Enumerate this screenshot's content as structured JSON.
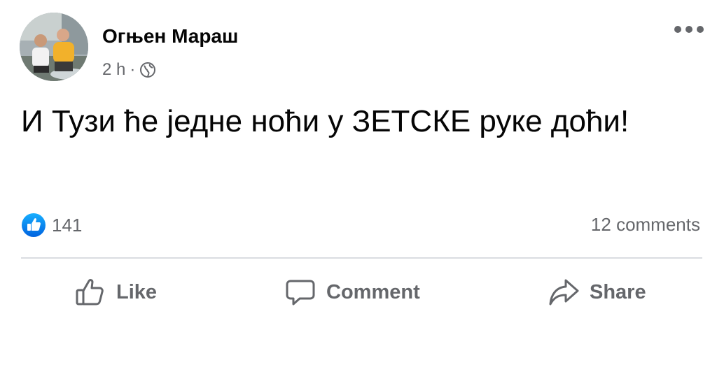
{
  "post": {
    "author": {
      "name": "Огњен Мараш",
      "avatar_icon": "profile-photo"
    },
    "time": "2 h",
    "separator": "·",
    "audience_icon": "globe-icon",
    "text": "И Тузи ће једне ноћи у ЗЕТСКЕ руке доћи!",
    "reactions": {
      "icon": "like-reaction-icon",
      "count": "141",
      "color": "#1877f2"
    },
    "comments": "12 comments"
  },
  "actions": {
    "like_label": "Like",
    "comment_label": "Comment",
    "share_label": "Share"
  },
  "colors": {
    "text_primary": "#050505",
    "text_secondary": "#65676b",
    "divider": "#dadde1",
    "brand_blue": "#1877f2"
  }
}
